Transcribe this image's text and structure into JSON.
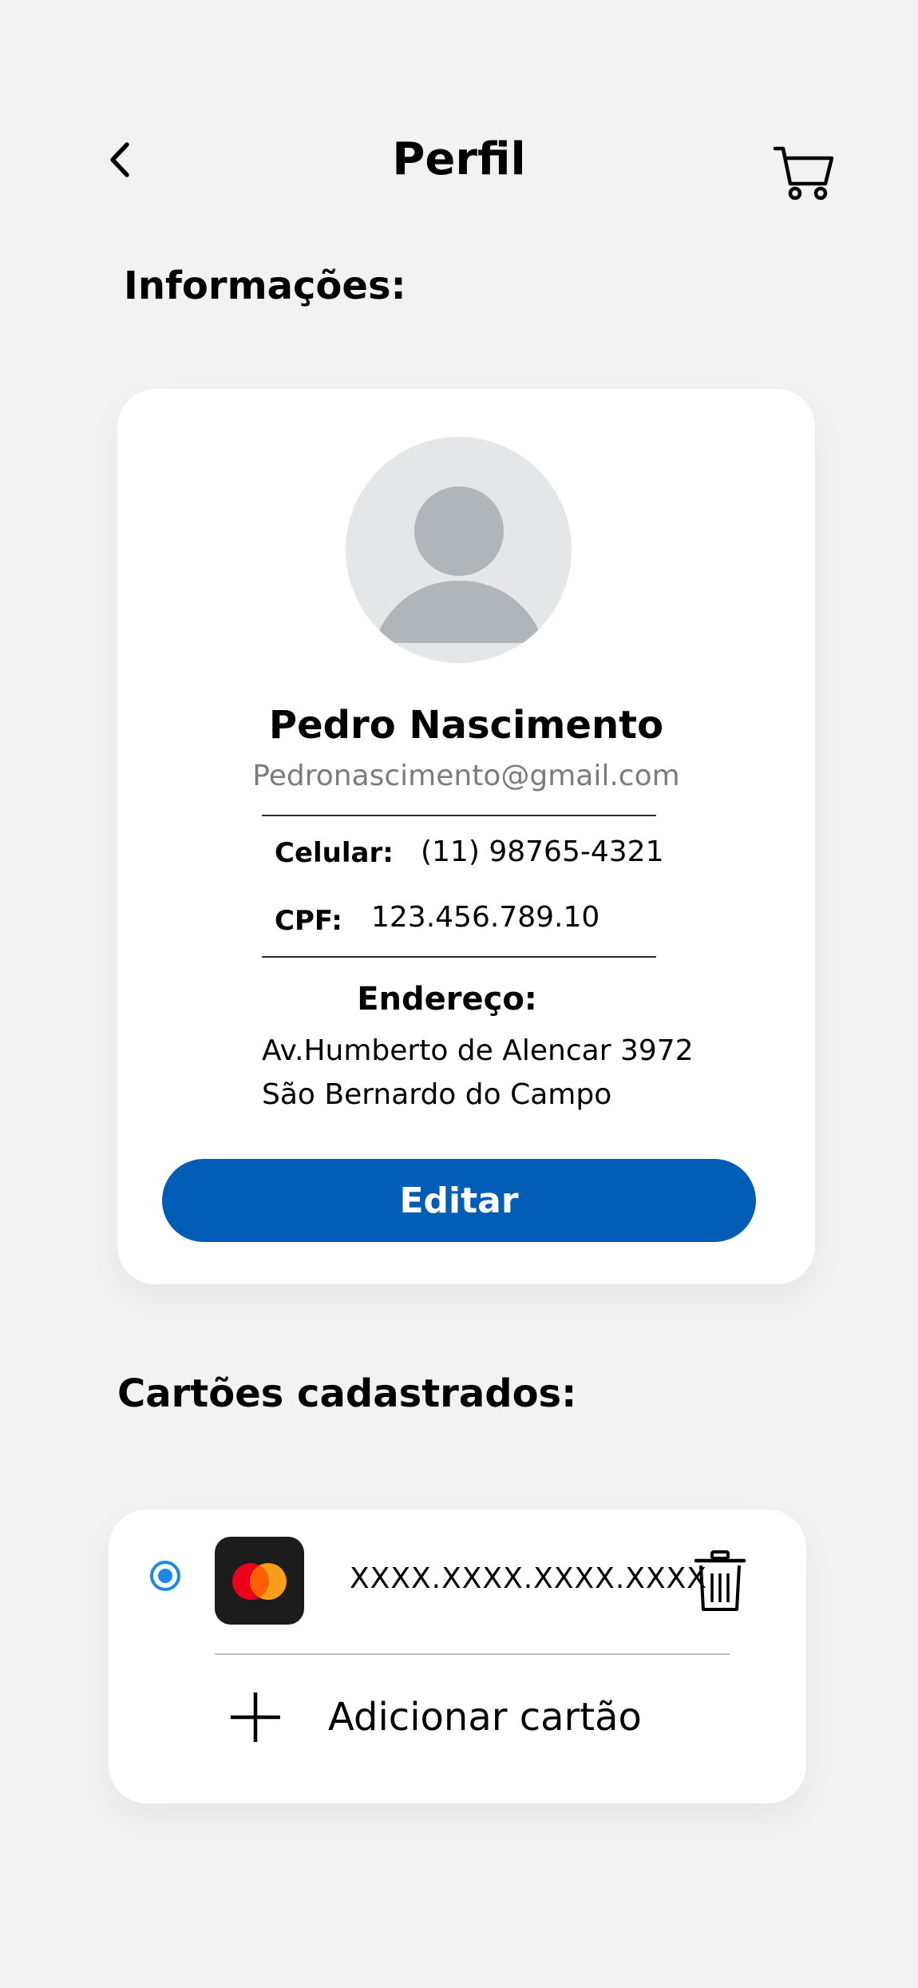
{
  "header": {
    "title": "Perfil",
    "back_icon": "chevron-left-icon",
    "cart_icon": "cart-icon"
  },
  "info_section": {
    "title": "Informações:"
  },
  "profile": {
    "avatar_icon": "user-avatar-icon",
    "name": "Pedro Nascimento",
    "email": "Pedronascimento@gmail.com",
    "phone_label": "Celular:",
    "phone_value": "(11) 98765-4321",
    "cpf_label": "CPF:",
    "cpf_value": "123.456.789.10",
    "address_label": "Endereço:",
    "address_line1": "Av.Humberto de Alencar 3972",
    "address_line2": "São Bernardo do Campo",
    "edit_label": "Editar"
  },
  "cards_section": {
    "title": "Cartões cadastrados:",
    "cards": [
      {
        "selected": true,
        "brand_icon": "mastercard-icon",
        "number": "XXXX.XXXX.XXXX.XXXX"
      }
    ],
    "add_label": "Adicionar cartão",
    "add_icon": "plus-icon",
    "delete_icon": "trash-icon"
  },
  "colors": {
    "background": "#f2f2f2",
    "primary": "#005cb5",
    "radio": "#1e88e5",
    "muted_text": "#7c7c7c"
  }
}
